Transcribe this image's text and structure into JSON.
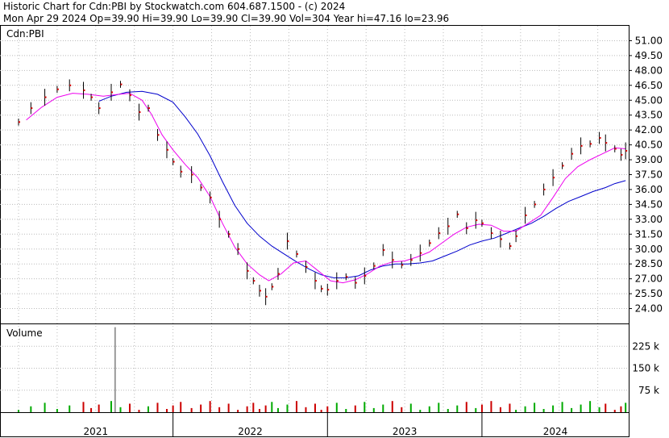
{
  "header": {
    "line1": "Historic Chart for Cdn:PBI by Stockwatch.com 604.687.1500 - (c) 2024",
    "line2": "Mon Apr 29 2024  Op=39.90  Hi=39.90  Lo=39.90  Cl=39.90  Vol=304  Year hi=47.16  lo=23.96"
  },
  "price_panel": {
    "label": "Cdn:PBI"
  },
  "volume_panel": {
    "label": "Volume"
  },
  "colors": {
    "price_bar": "#000000",
    "price_close": "#dd0000",
    "ma_short": "#ee00ee",
    "ma_long": "#0000cc",
    "grid": "#bbbbbb",
    "volume_up": "#00aa00",
    "volume_down": "#cc0000",
    "volume_spike": "#999999"
  },
  "chart_data": {
    "type": "line",
    "title": "Historic Chart for Cdn:PBI",
    "price_axis": {
      "ticks": [
        "51.00",
        "49.50",
        "48.00",
        "46.50",
        "45.00",
        "43.50",
        "42.00",
        "40.50",
        "39.00",
        "37.50",
        "36.00",
        "34.50",
        "33.00",
        "31.50",
        "30.00",
        "28.50",
        "27.00",
        "25.50",
        "24.00"
      ],
      "ylim": [
        22.5,
        52.5
      ]
    },
    "volume_axis": {
      "ticks": [
        "225 k",
        "150 k",
        "75 k"
      ],
      "ylim": [
        0,
        300000
      ]
    },
    "x_axis": {
      "labels": [
        "2021",
        "2022",
        "2023",
        "2024"
      ]
    },
    "series": [
      {
        "name": "price",
        "points": [
          [
            2021.0,
            42.8
          ],
          [
            2021.08,
            44.2
          ],
          [
            2021.17,
            45.3
          ],
          [
            2021.25,
            46.1
          ],
          [
            2021.33,
            46.5
          ],
          [
            2021.42,
            46.0
          ],
          [
            2021.47,
            45.3
          ],
          [
            2021.52,
            44.2
          ],
          [
            2021.6,
            45.8
          ],
          [
            2021.66,
            46.6
          ],
          [
            2021.72,
            45.5
          ],
          [
            2021.78,
            43.8
          ],
          [
            2021.84,
            44.2
          ],
          [
            2021.9,
            41.5
          ],
          [
            2021.96,
            40.0
          ],
          [
            2022.0,
            38.8
          ],
          [
            2022.05,
            37.8
          ],
          [
            2022.12,
            37.5
          ],
          [
            2022.18,
            36.2
          ],
          [
            2022.24,
            35.2
          ],
          [
            2022.3,
            33.0
          ],
          [
            2022.36,
            31.5
          ],
          [
            2022.42,
            30.0
          ],
          [
            2022.48,
            27.8
          ],
          [
            2022.52,
            26.8
          ],
          [
            2022.56,
            25.8
          ],
          [
            2022.6,
            25.2
          ],
          [
            2022.64,
            26.2
          ],
          [
            2022.68,
            27.5
          ],
          [
            2022.74,
            30.8
          ],
          [
            2022.8,
            29.5
          ],
          [
            2022.86,
            28.2
          ],
          [
            2022.92,
            26.8
          ],
          [
            2022.96,
            26.0
          ],
          [
            2023.0,
            25.9
          ],
          [
            2023.06,
            26.8
          ],
          [
            2023.12,
            27.2
          ],
          [
            2023.18,
            26.6
          ],
          [
            2023.24,
            27.3
          ],
          [
            2023.3,
            28.3
          ],
          [
            2023.36,
            29.9
          ],
          [
            2023.42,
            28.9
          ],
          [
            2023.48,
            28.4
          ],
          [
            2023.54,
            28.9
          ],
          [
            2023.6,
            29.6
          ],
          [
            2023.66,
            30.6
          ],
          [
            2023.72,
            31.6
          ],
          [
            2023.78,
            32.3
          ],
          [
            2023.84,
            33.5
          ],
          [
            2023.9,
            32.1
          ],
          [
            2023.96,
            32.9
          ],
          [
            2024.0,
            32.6
          ],
          [
            2024.06,
            31.6
          ],
          [
            2024.12,
            31.0
          ],
          [
            2024.18,
            30.3
          ],
          [
            2024.22,
            31.3
          ],
          [
            2024.28,
            33.4
          ],
          [
            2024.34,
            34.5
          ],
          [
            2024.4,
            36.0
          ],
          [
            2024.46,
            37.2
          ],
          [
            2024.52,
            38.4
          ],
          [
            2024.58,
            39.6
          ],
          [
            2024.64,
            40.4
          ],
          [
            2024.7,
            40.6
          ],
          [
            2024.76,
            41.2
          ],
          [
            2024.8,
            40.7
          ],
          [
            2024.86,
            40.1
          ],
          [
            2024.9,
            39.5
          ],
          [
            2024.93,
            39.9
          ]
        ]
      },
      {
        "name": "ma_short",
        "points": [
          [
            2021.05,
            43.0
          ],
          [
            2021.15,
            44.3
          ],
          [
            2021.25,
            45.3
          ],
          [
            2021.35,
            45.7
          ],
          [
            2021.45,
            45.6
          ],
          [
            2021.55,
            45.4
          ],
          [
            2021.65,
            45.6
          ],
          [
            2021.72,
            45.7
          ],
          [
            2021.8,
            45.0
          ],
          [
            2021.86,
            43.6
          ],
          [
            2021.93,
            41.5
          ],
          [
            2022.0,
            40.0
          ],
          [
            2022.08,
            38.5
          ],
          [
            2022.16,
            37.2
          ],
          [
            2022.24,
            35.3
          ],
          [
            2022.32,
            32.6
          ],
          [
            2022.4,
            30.2
          ],
          [
            2022.48,
            28.5
          ],
          [
            2022.56,
            27.4
          ],
          [
            2022.62,
            26.8
          ],
          [
            2022.7,
            27.5
          ],
          [
            2022.78,
            28.6
          ],
          [
            2022.86,
            28.8
          ],
          [
            2022.94,
            27.8
          ],
          [
            2023.02,
            26.8
          ],
          [
            2023.1,
            26.6
          ],
          [
            2023.18,
            26.9
          ],
          [
            2023.26,
            27.5
          ],
          [
            2023.34,
            28.3
          ],
          [
            2023.42,
            28.7
          ],
          [
            2023.5,
            28.8
          ],
          [
            2023.58,
            29.2
          ],
          [
            2023.66,
            29.7
          ],
          [
            2023.74,
            30.6
          ],
          [
            2023.82,
            31.5
          ],
          [
            2023.9,
            32.2
          ],
          [
            2023.98,
            32.5
          ],
          [
            2024.06,
            32.4
          ],
          [
            2024.14,
            31.8
          ],
          [
            2024.22,
            31.8
          ],
          [
            2024.3,
            32.6
          ],
          [
            2024.38,
            33.4
          ],
          [
            2024.46,
            35.2
          ],
          [
            2024.54,
            37.1
          ],
          [
            2024.62,
            38.3
          ],
          [
            2024.7,
            39.0
          ],
          [
            2024.78,
            39.6
          ],
          [
            2024.86,
            40.2
          ],
          [
            2024.93,
            40.1
          ]
        ]
      },
      {
        "name": "ma_long",
        "points": [
          [
            2021.52,
            44.9
          ],
          [
            2021.6,
            45.4
          ],
          [
            2021.7,
            45.8
          ],
          [
            2021.8,
            45.9
          ],
          [
            2021.9,
            45.6
          ],
          [
            2022.0,
            44.8
          ],
          [
            2022.08,
            43.3
          ],
          [
            2022.16,
            41.6
          ],
          [
            2022.24,
            39.4
          ],
          [
            2022.32,
            36.8
          ],
          [
            2022.4,
            34.4
          ],
          [
            2022.48,
            32.6
          ],
          [
            2022.56,
            31.3
          ],
          [
            2022.64,
            30.3
          ],
          [
            2022.72,
            29.5
          ],
          [
            2022.8,
            28.7
          ],
          [
            2022.88,
            28.0
          ],
          [
            2022.96,
            27.4
          ],
          [
            2023.04,
            27.1
          ],
          [
            2023.12,
            27.1
          ],
          [
            2023.2,
            27.3
          ],
          [
            2023.28,
            27.9
          ],
          [
            2023.36,
            28.3
          ],
          [
            2023.44,
            28.5
          ],
          [
            2023.52,
            28.5
          ],
          [
            2023.6,
            28.6
          ],
          [
            2023.68,
            28.8
          ],
          [
            2023.76,
            29.3
          ],
          [
            2023.84,
            29.8
          ],
          [
            2023.92,
            30.4
          ],
          [
            2024.0,
            30.8
          ],
          [
            2024.08,
            31.1
          ],
          [
            2024.16,
            31.6
          ],
          [
            2024.24,
            32.1
          ],
          [
            2024.32,
            32.6
          ],
          [
            2024.4,
            33.3
          ],
          [
            2024.48,
            34.1
          ],
          [
            2024.56,
            34.8
          ],
          [
            2024.64,
            35.3
          ],
          [
            2024.72,
            35.8
          ],
          [
            2024.8,
            36.2
          ],
          [
            2024.86,
            36.6
          ],
          [
            2024.93,
            36.9
          ]
        ]
      }
    ],
    "volume_spike": {
      "x": 2021.62,
      "value": 290000
    }
  }
}
